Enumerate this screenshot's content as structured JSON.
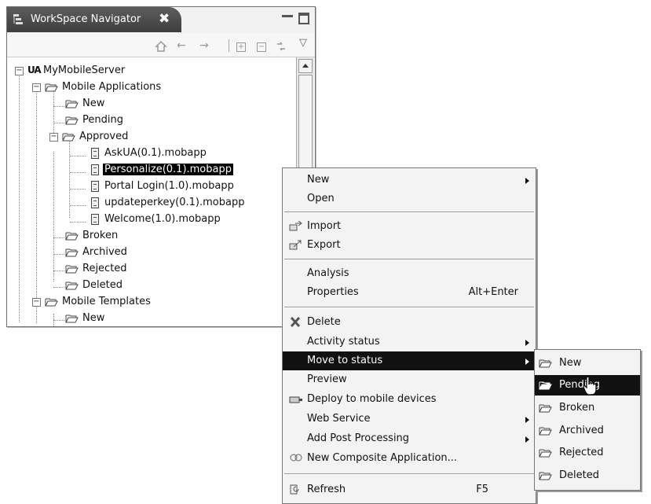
{
  "navigator": {
    "title": "WorkSpace Navigator",
    "close_glyph": "✖",
    "toolbar": {
      "back": "←",
      "forward": "→",
      "expand": "+",
      "collapse": "−",
      "view_menu": "▽"
    },
    "tree": [
      {
        "label": "MyMobileServer",
        "icon": "server-icon",
        "expanded": true
      },
      {
        "label": "Mobile Applications",
        "icon": "folder-icon",
        "expanded": true
      },
      {
        "label": "New",
        "icon": "folder-icon"
      },
      {
        "label": "Pending",
        "icon": "folder-icon"
      },
      {
        "label": "Approved",
        "icon": "folder-icon",
        "expanded": true
      },
      {
        "label": "AskUA(0.1).mobapp",
        "icon": "file-icon"
      },
      {
        "label": "Personalize(0.1).mobapp",
        "icon": "file-icon",
        "selected": true
      },
      {
        "label": "Portal Login(1.0).mobapp",
        "icon": "file-icon"
      },
      {
        "label": "updateperkey(0.1).mobapp",
        "icon": "file-icon"
      },
      {
        "label": "Welcome(1.0).mobapp",
        "icon": "file-icon"
      },
      {
        "label": "Broken",
        "icon": "folder-icon"
      },
      {
        "label": "Archived",
        "icon": "folder-icon"
      },
      {
        "label": "Rejected",
        "icon": "folder-icon"
      },
      {
        "label": "Deleted",
        "icon": "folder-icon"
      },
      {
        "label": "Mobile Templates",
        "icon": "folder-icon",
        "expanded": true
      },
      {
        "label": "New",
        "icon": "folder-icon"
      }
    ],
    "server_badge": "UA"
  },
  "context_menu": {
    "items": [
      {
        "label": "New",
        "submenu": true
      },
      {
        "label": "Open"
      },
      {
        "label": "Import",
        "icon": "import-icon"
      },
      {
        "label": "Export",
        "icon": "export-icon"
      },
      {
        "label": "Analysis"
      },
      {
        "label": "Properties",
        "shortcut": "Alt+Enter"
      },
      {
        "label": "Delete",
        "icon": "delete-icon"
      },
      {
        "label": "Activity status",
        "submenu": true
      },
      {
        "label": "Move to status",
        "submenu": true,
        "highlighted": true
      },
      {
        "label": "Preview"
      },
      {
        "label": "Deploy to mobile devices",
        "icon": "deploy-icon"
      },
      {
        "label": "Web Service",
        "submenu": true
      },
      {
        "label": "Add Post Processing",
        "submenu": true
      },
      {
        "label": "New Composite Application...",
        "icon": "composite-icon"
      },
      {
        "label": "Refresh",
        "icon": "refresh-icon",
        "shortcut": "F5"
      }
    ]
  },
  "status_submenu": {
    "items": [
      {
        "label": "New"
      },
      {
        "label": "Pending",
        "highlighted": true
      },
      {
        "label": "Broken"
      },
      {
        "label": "Archived"
      },
      {
        "label": "Rejected"
      },
      {
        "label": "Deleted"
      }
    ]
  }
}
